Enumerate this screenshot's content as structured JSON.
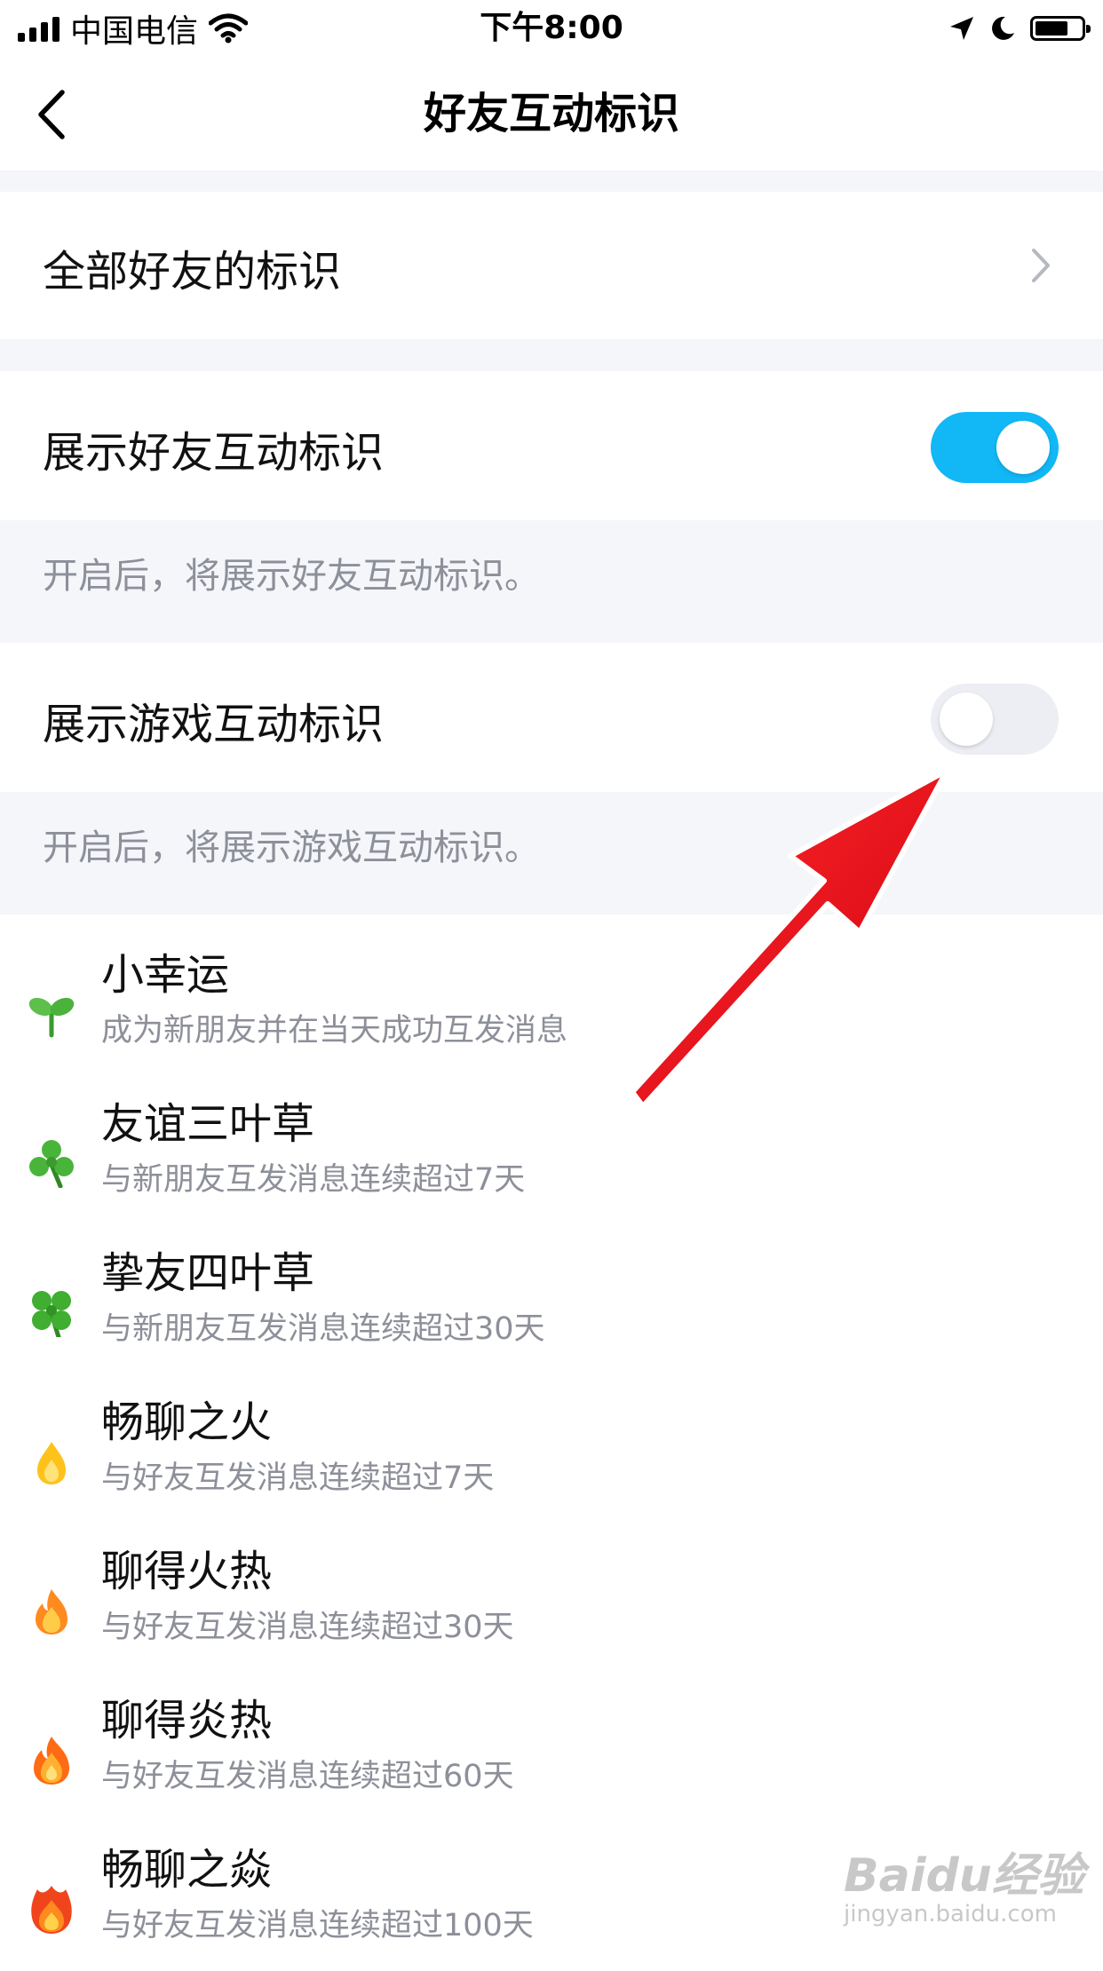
{
  "status_bar": {
    "carrier": "中国电信",
    "time": "下午8:00"
  },
  "nav": {
    "title": "好友互动标识"
  },
  "all_friends_row": {
    "label": "全部好友的标识"
  },
  "friend_toggle": {
    "label": "展示好友互动标识",
    "on": true,
    "hint": "开启后，将展示好友互动标识。"
  },
  "game_toggle": {
    "label": "展示游戏互动标识",
    "on": false,
    "hint": "开启后，将展示游戏互动标识。"
  },
  "badges": [
    {
      "icon": "sprout-icon",
      "title": "小幸运",
      "desc": "成为新朋友并在当天成功互发消息"
    },
    {
      "icon": "three-leaf-clover-icon",
      "title": "友谊三叶草",
      "desc": "与新朋友互发消息连续超过7天"
    },
    {
      "icon": "four-leaf-clover-icon",
      "title": "挚友四叶草",
      "desc": "与新朋友互发消息连续超过30天"
    },
    {
      "icon": "small-flame-icon",
      "title": "畅聊之火",
      "desc": "与好友互发消息连续超过7天"
    },
    {
      "icon": "flame-icon",
      "title": "聊得火热",
      "desc": "与好友互发消息连续超过30天"
    },
    {
      "icon": "big-flame-icon",
      "title": "聊得炎热",
      "desc": "与好友互发消息连续超过60天"
    },
    {
      "icon": "blaze-icon",
      "title": "畅聊之焱",
      "desc": "与好友互发消息连续超过100天"
    }
  ],
  "watermark": {
    "brand": "Baidu经验",
    "url": "jingyan.baidu.com"
  },
  "colors": {
    "toggle_on": "#12b7f5",
    "toggle_off": "#eceef3",
    "section_gap": "#f5f6fa",
    "hint_text": "#8d8f99",
    "arrow": "#e8101c"
  }
}
